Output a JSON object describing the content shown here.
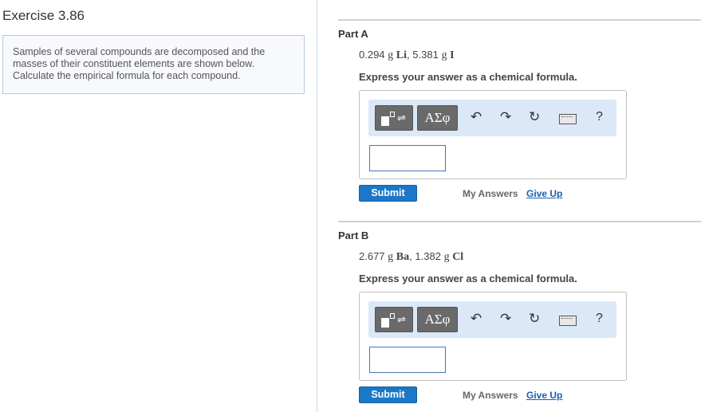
{
  "exercise": {
    "title": "Exercise 3.86",
    "problem_text": "Samples of several compounds are decomposed and the masses of their constituent elements are shown below. Calculate the empirical formula for each compound."
  },
  "parts": [
    {
      "label": "Part A",
      "mass1": "0.294",
      "unit1": "g",
      "element1": "Li",
      "sep": ",",
      "mass2": "5.381",
      "unit2": "g",
      "element2": "I",
      "instruction": "Express your answer as a chemical formula.",
      "answer_value": "",
      "submit_label": "Submit",
      "my_answers_label": "My Answers",
      "give_up_label": "Give Up"
    },
    {
      "label": "Part B",
      "mass1": "2.677",
      "unit1": "g",
      "element1": "Ba",
      "sep": ",",
      "mass2": "1.382",
      "unit2": "g",
      "element2": "Cl",
      "instruction": "Express your answer as a chemical formula.",
      "answer_value": "",
      "submit_label": "Submit",
      "my_answers_label": "My Answers",
      "give_up_label": "Give Up"
    }
  ],
  "toolbar": {
    "template_arrow": "⇌",
    "greek_label": "ΑΣφ",
    "undo_icon": "↶",
    "redo_icon": "↷",
    "reset_icon": "↻",
    "keyboard_icon": "keyboard-icon",
    "help_label": "?"
  },
  "colors": {
    "submit_blue": "#1b78c8",
    "toolbar_bg": "#dbe8f8",
    "link_blue": "#1a5fb4"
  }
}
